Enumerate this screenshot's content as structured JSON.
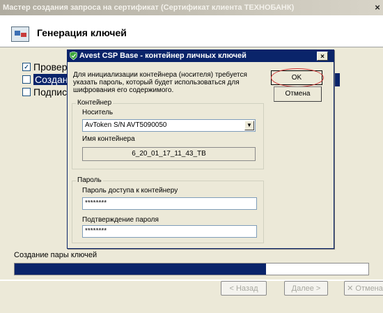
{
  "wizard": {
    "title": "Мастер создания запроса на сертификат (Сертификат клиента ТЕХНОБАНК)",
    "close_glyph": "×",
    "header_title": "Генерация ключей",
    "steps": [
      {
        "label": "Провер",
        "checked": true,
        "check_glyph": "✓"
      },
      {
        "label": "Создан",
        "checked": false,
        "selected": true
      },
      {
        "label": "Подпис",
        "checked": false
      }
    ],
    "progress_label": "Создание пары ключей",
    "progress_fraction": 0.71,
    "buttons": {
      "back": "< Назад",
      "next": "Далее >",
      "cancel": "Отмена"
    }
  },
  "dialog": {
    "title": "Avest CSP Base - контейнер личных ключей",
    "close_glyph": "×",
    "description": "Для инициализации контейнера (носителя) требуется указать пароль, который будет использоваться для шифрования его содержимого.",
    "ok_label": "OK",
    "cancel_label": "Отмена",
    "container_group": {
      "label": "Контейнер",
      "media_label": "Носитель",
      "media_value": "AvToken S/N AVT5090050",
      "name_label": "Имя контейнера",
      "name_value": "6_20_01_17_11_43_TB"
    },
    "password_group": {
      "label": "Пароль",
      "password_label": "Пароль доступа к контейнеру",
      "password_value": "********",
      "confirm_label": "Подтверждение пароля",
      "confirm_value": "********"
    }
  },
  "colors": {
    "selection": "#0a246a",
    "dialog_titlebar": "#0a246a",
    "window_bg": "#ece9d8",
    "ok_highlight": "#d03030"
  }
}
